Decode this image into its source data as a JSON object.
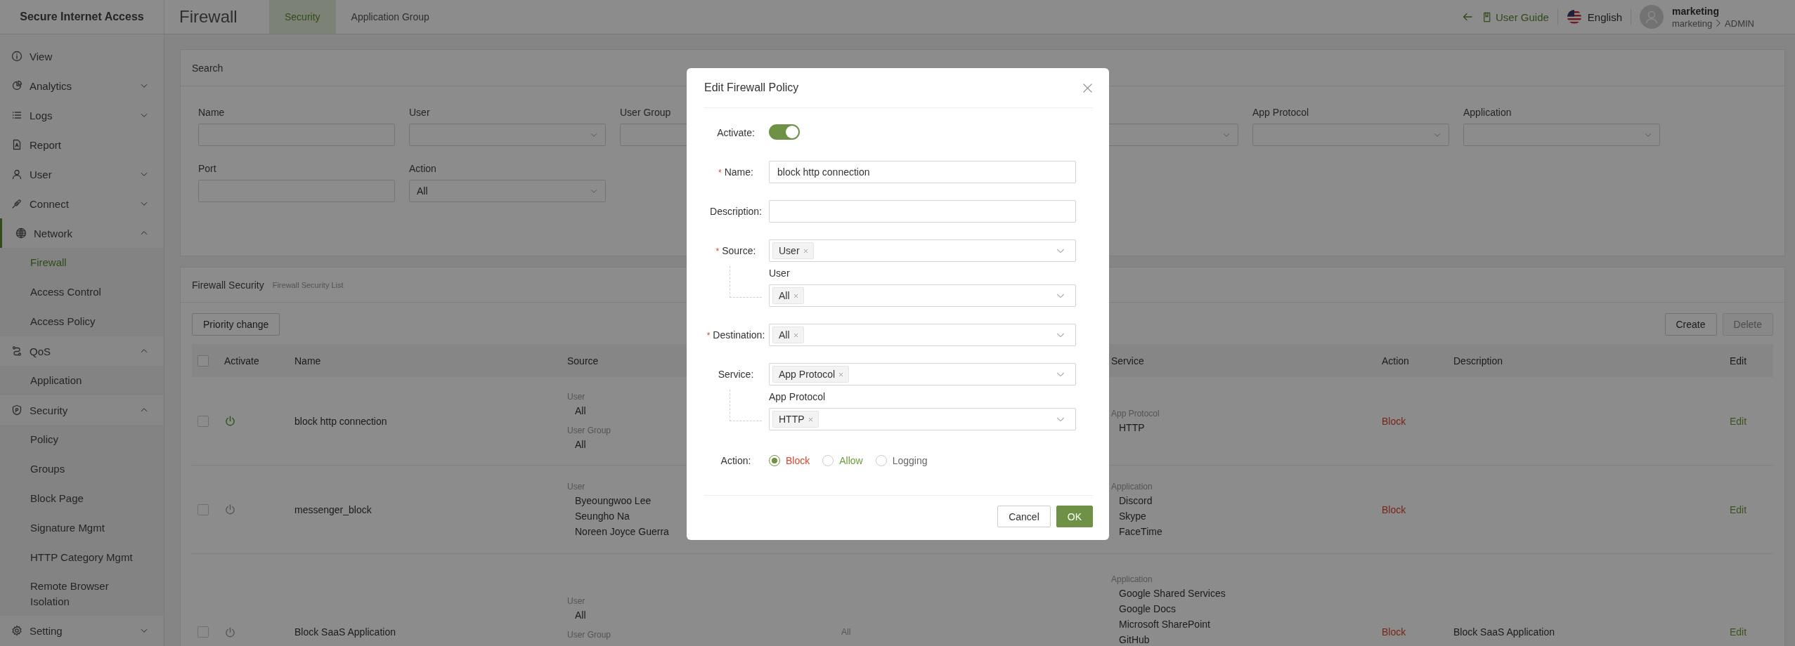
{
  "sidebar": {
    "title": "Secure Internet Access",
    "items": [
      {
        "label": "View",
        "selected": false
      },
      {
        "label": "Analytics",
        "selected": false,
        "expanded": false
      },
      {
        "label": "Logs",
        "selected": false,
        "expanded": false
      },
      {
        "label": "Report",
        "selected": false
      },
      {
        "label": "User",
        "selected": false,
        "expanded": false
      },
      {
        "label": "Connect",
        "selected": false,
        "expanded": false
      },
      {
        "label": "Network",
        "selected": true,
        "expanded": true,
        "children": [
          {
            "label": "Firewall",
            "selected": true
          },
          {
            "label": "Access Control",
            "selected": false
          },
          {
            "label": "Access Policy",
            "selected": false
          }
        ]
      },
      {
        "label": "QoS",
        "selected": false,
        "expanded": true,
        "children": [
          {
            "label": "Application",
            "selected": false
          }
        ]
      },
      {
        "label": "Security",
        "selected": false,
        "expanded": true,
        "children": [
          {
            "label": "Policy",
            "selected": false
          },
          {
            "label": "Groups",
            "selected": false
          },
          {
            "label": "Block Page",
            "selected": false
          },
          {
            "label": "Signature Mgmt",
            "selected": false
          },
          {
            "label": "HTTP Category Mgmt",
            "selected": false
          },
          {
            "label": "Remote Browser Isolation",
            "selected": false
          }
        ]
      },
      {
        "label": "Setting",
        "selected": false,
        "expanded": false
      }
    ]
  },
  "header": {
    "title": "Firewall",
    "tabs": [
      {
        "label": "Security",
        "selected": true
      },
      {
        "label": "Application Group",
        "selected": false
      }
    ],
    "user_guide": "User Guide",
    "language": "English",
    "user": {
      "name": "marketing",
      "org": "marketing",
      "role": "ADMIN"
    }
  },
  "search": {
    "title": "Search",
    "fields": [
      {
        "label": "Name",
        "kind": "text"
      },
      {
        "label": "User",
        "kind": "select"
      },
      {
        "label": "User Group",
        "kind": "text"
      }
    ],
    "fields_right": [
      {
        "kind": "select"
      },
      {
        "label": "App Protocol",
        "kind": "select"
      },
      {
        "label": "Application",
        "kind": "select"
      }
    ],
    "fields_row2": [
      {
        "label": "Port",
        "kind": "text"
      },
      {
        "label": "Action",
        "kind": "select",
        "value": "All"
      }
    ]
  },
  "table": {
    "title": "Firewall Security",
    "subtitle": "Firewall Security List",
    "left_buttons": [
      {
        "label": "Priority change",
        "disabled": false
      }
    ],
    "right_buttons": [
      {
        "label": "Create",
        "disabled": false
      },
      {
        "label": "Delete",
        "disabled": true
      }
    ],
    "select_all": {
      "checked": false
    },
    "columns": [
      {
        "kind": "activate",
        "label": "Activate"
      },
      {
        "kind": "name",
        "label": "Name"
      },
      {
        "kind": "source",
        "label": "Source"
      },
      {
        "kind": "destination"
      },
      {
        "kind": "service",
        "label": "Service"
      },
      {
        "kind": "action",
        "label": "Action"
      },
      {
        "kind": "description",
        "label": "Description"
      },
      {
        "kind": "edit",
        "label": "Edit"
      }
    ],
    "rows": [
      {
        "checked": false,
        "active": true,
        "name": "block http connection",
        "source": [
          {
            "label": "User",
            "values": [
              "All"
            ]
          },
          {
            "label": "User Group",
            "values": [
              "All"
            ]
          }
        ],
        "service": [
          {
            "label": "App Protocol",
            "values": [
              "HTTP"
            ]
          }
        ],
        "action": "Block",
        "edit": "Edit"
      },
      {
        "checked": false,
        "active": false,
        "name": "messenger_block",
        "source": [
          {
            "label": "User",
            "values": [
              "Byeoungwoo Lee",
              "Seungho Na",
              "Noreen Joyce Guerra"
            ]
          }
        ],
        "service": [
          {
            "label": "Application",
            "values": [
              "Discord",
              "Skype",
              "FaceTime"
            ]
          }
        ],
        "action": "Block",
        "edit": "Edit"
      },
      {
        "checked": false,
        "active": false,
        "name": "Block SaaS Application",
        "source": [
          {
            "label": "User",
            "values": [
              "All"
            ]
          },
          {
            "label": "User Group"
          }
        ],
        "destination": "All",
        "service": [
          {
            "label": "Application",
            "values": [
              "Google Shared Services",
              "Google Docs",
              "Microsoft SharePoint",
              "GitHub"
            ]
          }
        ],
        "action": "Block",
        "description": "Block SaaS Application",
        "edit": "Edit"
      }
    ]
  },
  "modal": {
    "title": "Edit Firewall Policy",
    "fields": [
      {
        "kind": "toggle",
        "label": "Activate:",
        "on": true
      },
      {
        "kind": "text",
        "label": "Name:",
        "required_mark": "*",
        "value": "block http connection"
      },
      {
        "kind": "text",
        "label": "Description:"
      },
      {
        "kind": "tags",
        "label": "Source:",
        "required_mark": "*",
        "tags": [
          "User"
        ],
        "sub": {
          "label": "User",
          "tags": [
            "All"
          ]
        }
      },
      {
        "kind": "tags",
        "label": "Destination:",
        "required_mark": "*",
        "tags": [
          "All"
        ]
      },
      {
        "kind": "tags",
        "label": "Service:",
        "tags": [
          "App Protocol"
        ],
        "sub": {
          "label": "App Protocol",
          "tags": [
            "HTTP"
          ]
        }
      },
      {
        "kind": "radio",
        "label": "Action:",
        "options": [
          {
            "label": "Block",
            "selected": true,
            "color": "#d9452c"
          },
          {
            "label": "Allow",
            "selected": false,
            "color": "#6b9a3a"
          },
          {
            "label": "Logging",
            "selected": false,
            "color": "#666666"
          }
        ]
      }
    ],
    "buttons": [
      {
        "label": "Cancel",
        "kind": "secondary"
      },
      {
        "label": "OK",
        "kind": "primary"
      }
    ]
  }
}
